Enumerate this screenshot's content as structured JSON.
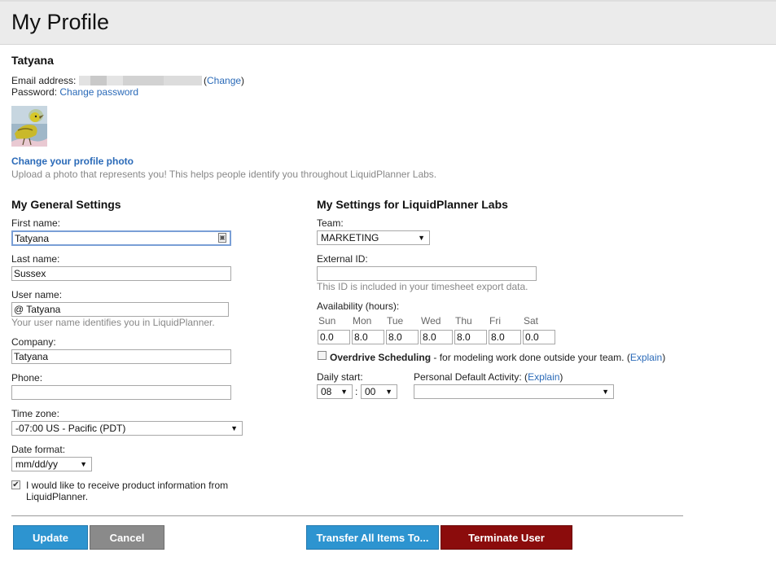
{
  "page_title": "My Profile",
  "user": {
    "name": "Tatyana",
    "email_label": "Email address:",
    "email_change_prefix": "(",
    "email_change_link": "Change",
    "email_change_suffix": ")",
    "password_label": "Password:",
    "password_change_link": "Change password",
    "photo_change_link": "Change your profile photo",
    "photo_hint": "Upload a photo that represents you! This helps people identify you throughout LiquidPlanner Labs."
  },
  "general": {
    "title": "My General Settings",
    "first_name_label": "First name:",
    "first_name_value": "Tatyana",
    "last_name_label": "Last name:",
    "last_name_value": "Sussex",
    "user_name_label": "User name:",
    "user_name_value": "@ Tatyana",
    "user_name_hint": "Your user name identifies you in LiquidPlanner.",
    "company_label": "Company:",
    "company_value": "Tatyana",
    "phone_label": "Phone:",
    "phone_value": "",
    "timezone_label": "Time zone:",
    "timezone_value": "-07:00 US - Pacific (PDT)",
    "date_format_label": "Date format:",
    "date_format_value": "mm/dd/yy",
    "newsletter_line1": "I would like to receive product information from",
    "newsletter_line2": "LiquidPlanner.",
    "newsletter_checked": true
  },
  "labs": {
    "title": "My Settings for LiquidPlanner Labs",
    "team_label": "Team:",
    "team_value": "MARKETING",
    "external_id_label": "External ID:",
    "external_id_value": "",
    "external_id_hint": "This ID is included in your timesheet export data.",
    "availability_label": "Availability (hours):",
    "availability": [
      {
        "day": "Sun",
        "hours": "0.0"
      },
      {
        "day": "Mon",
        "hours": "8.0"
      },
      {
        "day": "Tue",
        "hours": "8.0"
      },
      {
        "day": "Wed",
        "hours": "8.0"
      },
      {
        "day": "Thu",
        "hours": "8.0"
      },
      {
        "day": "Fri",
        "hours": "8.0"
      },
      {
        "day": "Sat",
        "hours": "0.0"
      }
    ],
    "overdrive_label": "Overdrive Scheduling",
    "overdrive_desc": " - for modeling work done outside your team. (",
    "overdrive_explain": "Explain",
    "overdrive_close": ")",
    "overdrive_checked": false,
    "daily_start_label": "Daily start:",
    "daily_start_hour": "08",
    "daily_start_sep": ":",
    "daily_start_min": "00",
    "default_activity_label": "Personal Default Activity: (",
    "default_activity_explain": "Explain",
    "default_activity_close": ")",
    "default_activity_value": ""
  },
  "buttons": {
    "update": "Update",
    "cancel": "Cancel",
    "transfer": "Transfer All Items To...",
    "terminate": "Terminate User"
  },
  "icons": {
    "dropdown_arrow": "▼",
    "checkmark": "✔",
    "contact_card": "▣"
  }
}
